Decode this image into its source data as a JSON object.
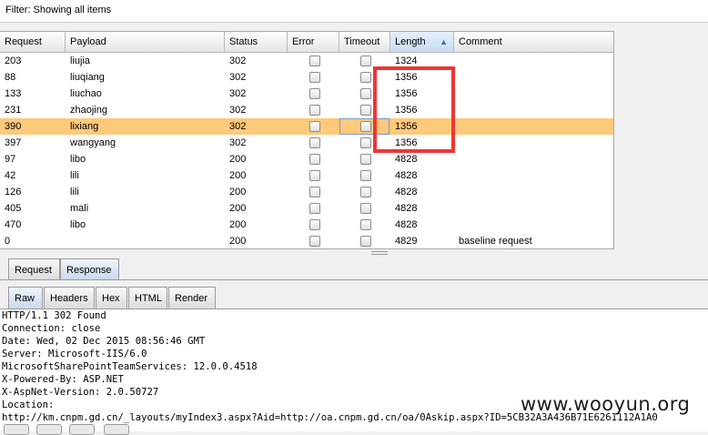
{
  "filter": {
    "text": "Filter: Showing all items"
  },
  "table": {
    "columns": [
      "Request",
      "Payload",
      "Status",
      "Error",
      "Timeout",
      "Length",
      "Comment"
    ],
    "sorted_column": "Length",
    "sort_direction": "ascending",
    "selected_row": 4,
    "rows": [
      {
        "request": "203",
        "payload": "liujia",
        "status": "302",
        "error": false,
        "timeout": false,
        "length": "1324",
        "comment": ""
      },
      {
        "request": "88",
        "payload": "liuqiang",
        "status": "302",
        "error": false,
        "timeout": false,
        "length": "1356",
        "comment": ""
      },
      {
        "request": "133",
        "payload": "liuchao",
        "status": "302",
        "error": false,
        "timeout": false,
        "length": "1356",
        "comment": ""
      },
      {
        "request": "231",
        "payload": "zhaojing",
        "status": "302",
        "error": false,
        "timeout": false,
        "length": "1356",
        "comment": ""
      },
      {
        "request": "390",
        "payload": "lixiang",
        "status": "302",
        "error": false,
        "timeout": false,
        "length": "1356",
        "comment": ""
      },
      {
        "request": "397",
        "payload": "wangyang",
        "status": "302",
        "error": false,
        "timeout": false,
        "length": "1356",
        "comment": ""
      },
      {
        "request": "97",
        "payload": "libo",
        "status": "200",
        "error": false,
        "timeout": false,
        "length": "4828",
        "comment": ""
      },
      {
        "request": "42",
        "payload": "lili",
        "status": "200",
        "error": false,
        "timeout": false,
        "length": "4828",
        "comment": ""
      },
      {
        "request": "126",
        "payload": "lili",
        "status": "200",
        "error": false,
        "timeout": false,
        "length": "4828",
        "comment": ""
      },
      {
        "request": "405",
        "payload": "mali",
        "status": "200",
        "error": false,
        "timeout": false,
        "length": "4828",
        "comment": ""
      },
      {
        "request": "470",
        "payload": "libo",
        "status": "200",
        "error": false,
        "timeout": false,
        "length": "4828",
        "comment": ""
      },
      {
        "request": "0",
        "payload": "",
        "status": "200",
        "error": false,
        "timeout": false,
        "length": "4829",
        "comment": "baseline request"
      }
    ]
  },
  "tabs_top": {
    "request": "Request",
    "response": "Response",
    "active": "Response"
  },
  "tabs_view": {
    "raw": "Raw",
    "headers": "Headers",
    "hex": "Hex",
    "html": "HTML",
    "render": "Render",
    "active": "Raw"
  },
  "response_lines": [
    "HTTP/1.1 302 Found",
    "Connection: close",
    "Date: Wed, 02 Dec 2015 08:56:46 GMT",
    "Server: Microsoft-IIS/6.0",
    "MicrosoftSharePointTeamServices: 12.0.0.4518",
    "X-Powered-By: ASP.NET",
    "X-AspNet-Version: 2.0.50727",
    "Location:",
    "http://km.cnpm.gd.cn/_layouts/myIndex3.aspx?Aid=http://oa.cnpm.gd.cn/oa/0Askip.aspx?ID=5CB32A3A436B71E6261112A1A0"
  ],
  "watermark": "www.wooyun.org",
  "colors": {
    "selected_row": "#fdc97a",
    "highlight_box": "#ef3535"
  }
}
